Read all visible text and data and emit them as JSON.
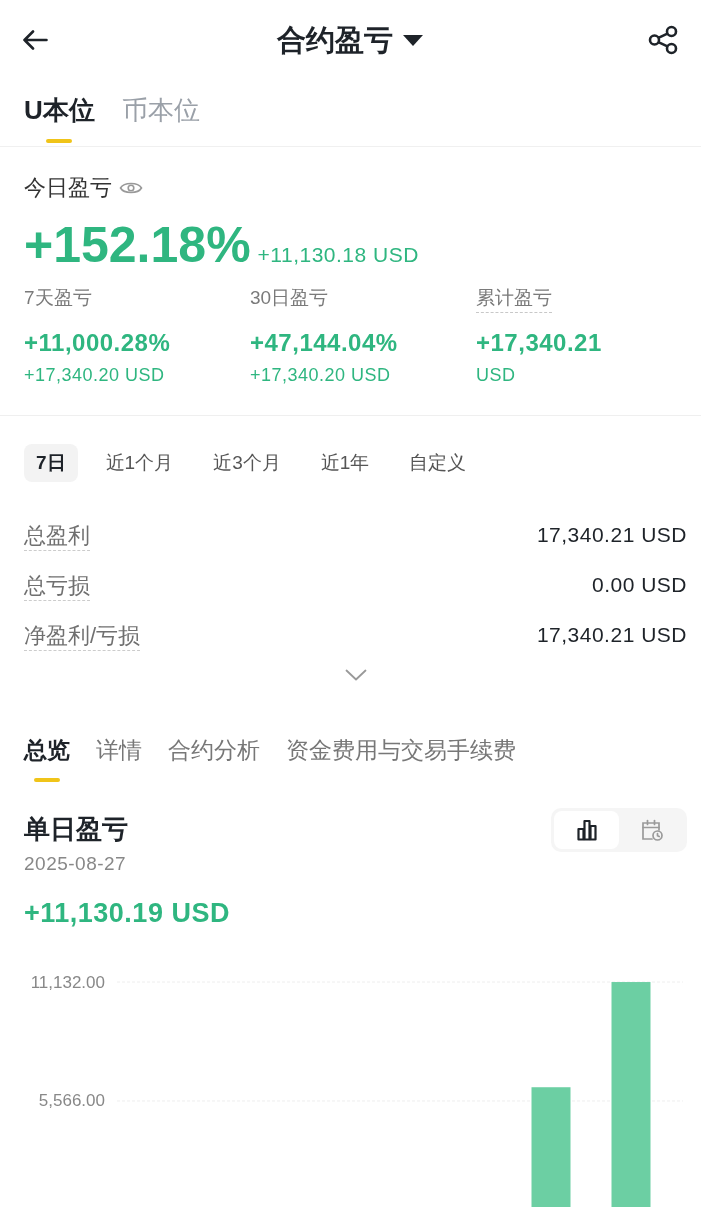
{
  "header": {
    "title": "合约盈亏"
  },
  "account_tabs": [
    {
      "label": "U本位",
      "selected": true
    },
    {
      "label": "币本位",
      "selected": false
    }
  ],
  "today": {
    "label": "今日盈亏",
    "percent": "+152.18%",
    "amount": "+11,130.18 USD"
  },
  "period_stats": [
    {
      "label": "7天盈亏",
      "dotted_underline": false,
      "value": "+11,000.28%",
      "sub": "+17,340.20 USD"
    },
    {
      "label": "30日盈亏",
      "dotted_underline": false,
      "value": "+47,144.04%",
      "sub": "+17,340.20 USD"
    },
    {
      "label": "累计盈亏",
      "dotted_underline": true,
      "value": "+17,340.21",
      "sub": "USD"
    }
  ],
  "range_chips": [
    {
      "label": "7日",
      "selected": true
    },
    {
      "label": "近1个月",
      "selected": false
    },
    {
      "label": "近3个月",
      "selected": false
    },
    {
      "label": "近1年",
      "selected": false
    },
    {
      "label": "自定义",
      "selected": false
    }
  ],
  "totals": [
    {
      "label": "总盈利",
      "value": "17,340.21 USD"
    },
    {
      "label": "总亏损",
      "value": "0.00 USD"
    },
    {
      "label": "净盈利/亏损",
      "value": "17,340.21 USD"
    }
  ],
  "detail_tabs": [
    {
      "label": "总览",
      "selected": true
    },
    {
      "label": "详情",
      "selected": false
    },
    {
      "label": "合约分析",
      "selected": false
    },
    {
      "label": "资金费用与交易手续费",
      "selected": false
    }
  ],
  "daily": {
    "title": "单日盈亏",
    "date": "2025-08-27",
    "amount": "+11,130.19 USD",
    "view_toggle": [
      {
        "kind": "bar_chart",
        "selected": true
      },
      {
        "kind": "calendar",
        "selected": false
      }
    ],
    "chart_data": {
      "type": "bar",
      "values": [
        null,
        null,
        null,
        null,
        null,
        6210,
        11130
      ],
      "ylim": [
        608,
        11132
      ],
      "yticks": [
        {
          "value": 5566,
          "label": "5,566.00"
        },
        {
          "value": 11132,
          "label": "11,132.00"
        }
      ]
    }
  }
}
